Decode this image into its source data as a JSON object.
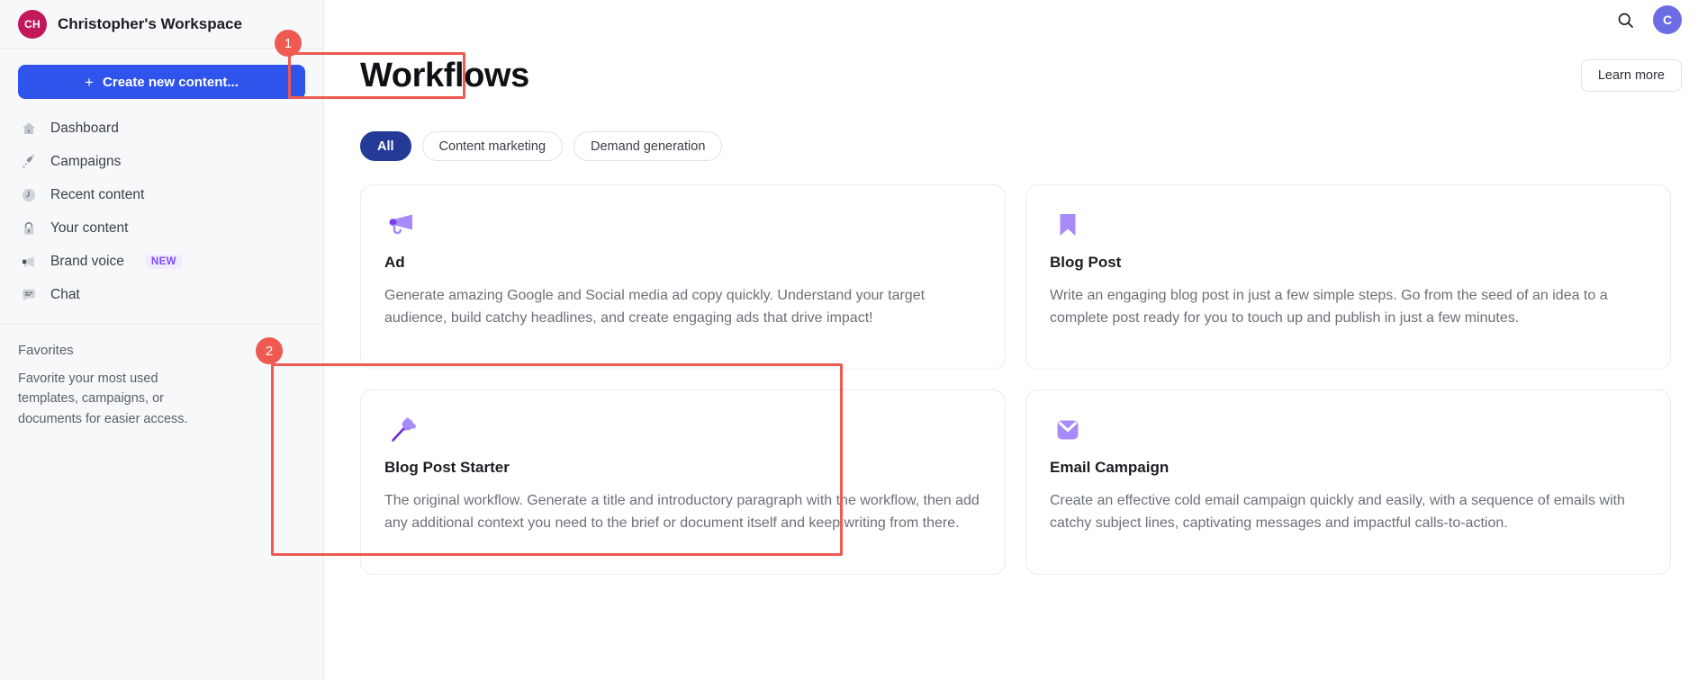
{
  "sidebar": {
    "workspace": {
      "initials": "CH",
      "name": "Christopher's Workspace",
      "avatar_color": "#c2185b"
    },
    "create_button": {
      "label": "Create new content...",
      "plus": "+",
      "color": "#2f54eb"
    },
    "items": [
      {
        "label": "Dashboard",
        "icon": "home-icon"
      },
      {
        "label": "Campaigns",
        "icon": "rocket-icon"
      },
      {
        "label": "Recent content",
        "icon": "clock-icon"
      },
      {
        "label": "Your content",
        "icon": "lock-icon"
      },
      {
        "label": "Brand voice",
        "icon": "megaphone-icon",
        "badge": "NEW"
      },
      {
        "label": "Chat",
        "icon": "chat-icon"
      }
    ],
    "favorites": {
      "title": "Favorites",
      "description": "Favorite your most used templates, campaigns, or documents for easier access."
    }
  },
  "topbar": {
    "search_icon": "search-icon",
    "user_avatar": {
      "initial": "C",
      "color": "#6c6ce5"
    }
  },
  "header": {
    "title": "Workflows",
    "learn_more": "Learn more"
  },
  "filters": {
    "chips": [
      {
        "label": "All",
        "active": true
      },
      {
        "label": "Content marketing",
        "active": false
      },
      {
        "label": "Demand generation",
        "active": false
      }
    ],
    "active_color": "#233b96"
  },
  "cards": [
    {
      "title": "Ad",
      "icon": "megaphone-icon",
      "description": "Generate amazing Google and Social media ad copy quickly. Understand your target audience, build catchy headlines, and create engaging ads that drive impact!"
    },
    {
      "title": "Blog Post",
      "icon": "bookmark-icon",
      "description": "Write an engaging blog post in just a few simple steps. Go from the seed of an idea to a complete post ready for you to touch up and publish in just a few minutes."
    },
    {
      "title": "Blog Post Starter",
      "icon": "magic-wand-icon",
      "description": "The original workflow. Generate a title and introductory paragraph with the workflow, then add any additional context you need to the brief or document itself and keep writing from there."
    },
    {
      "title": "Email Campaign",
      "icon": "envelope-icon",
      "description": "Create an effective cold email campaign quickly and easily, with a sequence of emails with catchy subject lines, captivating messages and impactful calls-to-action."
    }
  ],
  "annotations": {
    "color": "#ee5a52",
    "markers": [
      {
        "number": "1",
        "target": "page-title"
      },
      {
        "number": "2",
        "target": "card-blog-post-starter"
      }
    ]
  }
}
